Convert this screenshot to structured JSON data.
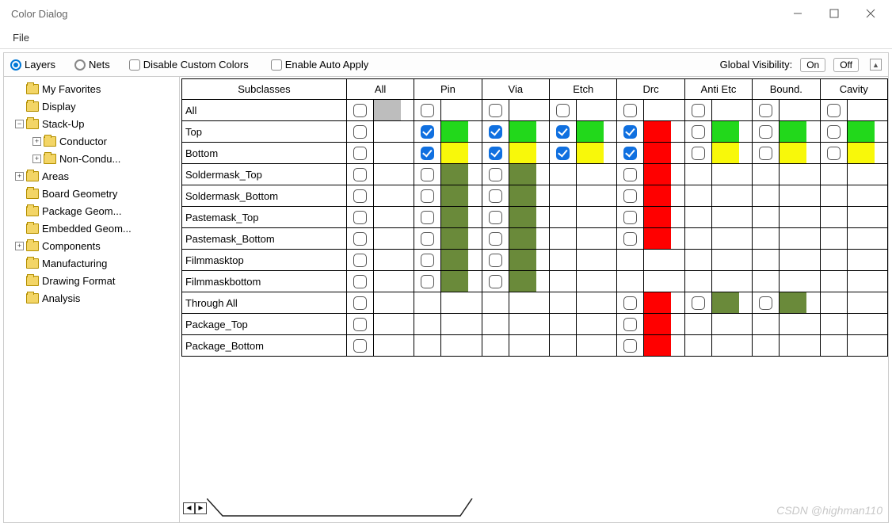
{
  "title": "Color Dialog",
  "menu": {
    "file": "File"
  },
  "toolbar": {
    "layers": "Layers",
    "nets": "Nets",
    "disable_custom": "Disable Custom Colors",
    "enable_auto": "Enable Auto Apply",
    "global_vis": "Global Visibility:",
    "on": "On",
    "off": "Off"
  },
  "tree": [
    {
      "indent": 0,
      "exp": "",
      "label": "My Favorites"
    },
    {
      "indent": 0,
      "exp": "",
      "label": "Display"
    },
    {
      "indent": 0,
      "exp": "-",
      "label": "Stack-Up"
    },
    {
      "indent": 1,
      "exp": "+",
      "label": "Conductor"
    },
    {
      "indent": 1,
      "exp": "+",
      "label": "Non-Condu..."
    },
    {
      "indent": 0,
      "exp": "+",
      "label": "Areas"
    },
    {
      "indent": 0,
      "exp": "",
      "label": "Board Geometry"
    },
    {
      "indent": 0,
      "exp": "",
      "label": "Package Geom..."
    },
    {
      "indent": 0,
      "exp": "",
      "label": "Embedded Geom..."
    },
    {
      "indent": 0,
      "exp": "+",
      "label": "Components"
    },
    {
      "indent": 0,
      "exp": "",
      "label": "Manufacturing"
    },
    {
      "indent": 0,
      "exp": "",
      "label": "Drawing Format"
    },
    {
      "indent": 0,
      "exp": "",
      "label": "Analysis"
    }
  ],
  "columns": [
    "Subclasses",
    "All",
    "Pin",
    "Via",
    "Etch",
    "Drc",
    "Anti Etc",
    "Bound.",
    "Cavity"
  ],
  "rows": [
    {
      "label": "All",
      "cells": {
        "All": {
          "cb": true,
          "col": "c-grey"
        },
        "Pin": {
          "cb": true
        },
        "Via": {
          "cb": true
        },
        "Etch": {
          "cb": true
        },
        "Drc": {
          "cb": true
        },
        "Anti Etc": {
          "cb": true
        },
        "Bound.": {
          "cb": true
        },
        "Cavity": {
          "cb": true
        }
      }
    },
    {
      "label": "Top",
      "cells": {
        "All": {
          "cb": true
        },
        "Pin": {
          "cb": true,
          "checked": true,
          "col": "c-green"
        },
        "Via": {
          "cb": true,
          "checked": true,
          "col": "c-green"
        },
        "Etch": {
          "cb": true,
          "checked": true,
          "col": "c-green"
        },
        "Drc": {
          "cb": true,
          "checked": true,
          "col": "c-red"
        },
        "Anti Etc": {
          "cb": true,
          "col": "c-green"
        },
        "Bound.": {
          "cb": true,
          "col": "c-green"
        },
        "Cavity": {
          "cb": true,
          "col": "c-green"
        }
      }
    },
    {
      "label": "Bottom",
      "cells": {
        "All": {
          "cb": true
        },
        "Pin": {
          "cb": true,
          "checked": true,
          "col": "c-yellow"
        },
        "Via": {
          "cb": true,
          "checked": true,
          "col": "c-yellow"
        },
        "Etch": {
          "cb": true,
          "checked": true,
          "col": "c-yellow"
        },
        "Drc": {
          "cb": true,
          "checked": true,
          "col": "c-red"
        },
        "Anti Etc": {
          "cb": true,
          "col": "c-yellow"
        },
        "Bound.": {
          "cb": true,
          "col": "c-yellow"
        },
        "Cavity": {
          "cb": true,
          "col": "c-yellow"
        }
      }
    },
    {
      "label": "Soldermask_Top",
      "cells": {
        "All": {
          "cb": true
        },
        "Pin": {
          "cb": true,
          "col": "c-olive"
        },
        "Via": {
          "cb": true,
          "col": "c-olive"
        },
        "Drc": {
          "cb": true,
          "col": "c-red"
        }
      }
    },
    {
      "label": "Soldermask_Bottom",
      "cells": {
        "All": {
          "cb": true
        },
        "Pin": {
          "cb": true,
          "col": "c-olive"
        },
        "Via": {
          "cb": true,
          "col": "c-olive"
        },
        "Drc": {
          "cb": true,
          "col": "c-red"
        }
      }
    },
    {
      "label": "Pastemask_Top",
      "cells": {
        "All": {
          "cb": true
        },
        "Pin": {
          "cb": true,
          "col": "c-olive"
        },
        "Via": {
          "cb": true,
          "col": "c-olive"
        },
        "Drc": {
          "cb": true,
          "col": "c-red"
        }
      }
    },
    {
      "label": "Pastemask_Bottom",
      "cells": {
        "All": {
          "cb": true
        },
        "Pin": {
          "cb": true,
          "col": "c-olive"
        },
        "Via": {
          "cb": true,
          "col": "c-olive"
        },
        "Drc": {
          "cb": true,
          "col": "c-red"
        }
      }
    },
    {
      "label": "Filmmasktop",
      "cells": {
        "All": {
          "cb": true
        },
        "Pin": {
          "cb": true,
          "col": "c-olive"
        },
        "Via": {
          "cb": true,
          "col": "c-olive"
        }
      }
    },
    {
      "label": "Filmmaskbottom",
      "cells": {
        "All": {
          "cb": true
        },
        "Pin": {
          "cb": true,
          "col": "c-olive"
        },
        "Via": {
          "cb": true,
          "col": "c-olive"
        }
      }
    },
    {
      "label": "Through All",
      "cells": {
        "All": {
          "cb": true
        },
        "Drc": {
          "cb": true,
          "col": "c-red"
        },
        "Anti Etc": {
          "cb": true,
          "col": "c-olive"
        },
        "Bound.": {
          "cb": true,
          "col": "c-olive"
        }
      }
    },
    {
      "label": "Package_Top",
      "cells": {
        "All": {
          "cb": true
        },
        "Drc": {
          "cb": true,
          "col": "c-red"
        }
      }
    },
    {
      "label": "Package_Bottom",
      "cells": {
        "All": {
          "cb": true
        },
        "Drc": {
          "cb": true,
          "col": "c-red"
        }
      }
    }
  ],
  "watermark": "CSDN @highman110"
}
